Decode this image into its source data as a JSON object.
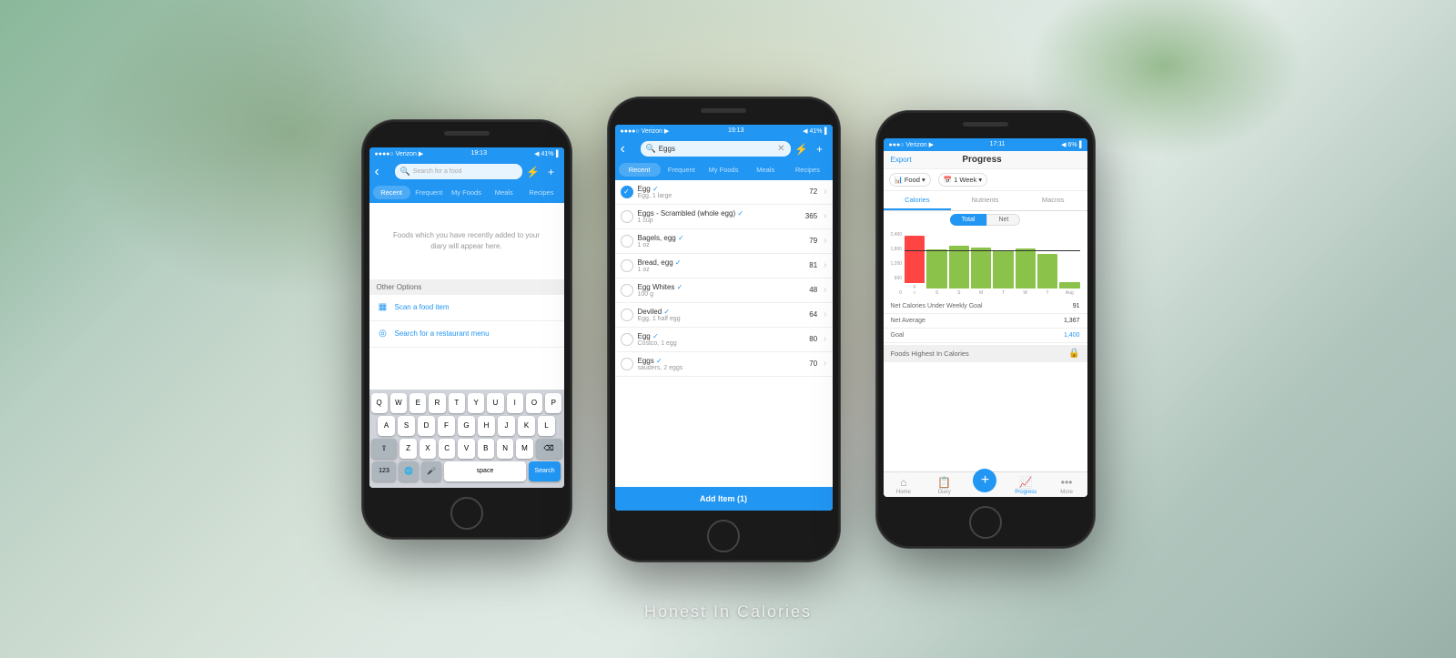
{
  "background": {
    "colors": [
      "#8ab89a",
      "#b8cfc4",
      "#dde8e2"
    ]
  },
  "honest_calories_text": "Honest In Calories",
  "phone_left": {
    "status": {
      "carrier": "●●●●○ Verizon ▶",
      "time": "19:13",
      "battery": "◀ 41%▐"
    },
    "header": {
      "back_label": "‹",
      "search_placeholder": "Search for a food",
      "filter_icon": "⚡",
      "add_icon": "+"
    },
    "tabs": [
      "Recent",
      "Frequent",
      "My Foods",
      "Meals",
      "Recipes"
    ],
    "active_tab": "Recent",
    "empty_state": "Foods which you have recently added to your diary will appear here.",
    "other_options_label": "Other Options",
    "menu_items": [
      {
        "icon": "▦",
        "label": "Scan a food item"
      },
      {
        "icon": "◎",
        "label": "Search for a restaurant menu"
      }
    ],
    "keyboard": {
      "row1": [
        "Q",
        "W",
        "E",
        "R",
        "T",
        "Y",
        "U",
        "I",
        "O",
        "P"
      ],
      "row2": [
        "A",
        "S",
        "D",
        "F",
        "G",
        "H",
        "J",
        "K",
        "L"
      ],
      "row3": [
        "⇧",
        "Z",
        "X",
        "C",
        "V",
        "B",
        "N",
        "M",
        "⌫"
      ],
      "row4_left": "123",
      "row4_globe": "🌐",
      "row4_mic": "🎤",
      "row4_space": "space",
      "row4_search": "Search"
    }
  },
  "phone_middle": {
    "status": {
      "carrier": "●●●●○ Verizon ▶",
      "time": "19:13",
      "battery": "◀ 41%▐"
    },
    "header": {
      "back_label": "‹",
      "search_value": "Eggs",
      "filter_icon": "⚡",
      "add_icon": "+"
    },
    "tabs": [
      "Recent",
      "Frequent",
      "My Foods",
      "Meals",
      "Recipes"
    ],
    "active_tab": "Recent",
    "foods": [
      {
        "name": "Egg ✓",
        "detail": "Egg, 1 large",
        "calories": 72,
        "checked": true,
        "verified": true
      },
      {
        "name": "Eggs - Scrambled (whole egg) ✓",
        "detail": "1 cup",
        "calories": 365,
        "checked": false,
        "verified": true
      },
      {
        "name": "Bagels, egg ✓",
        "detail": "1 oz",
        "calories": 79,
        "checked": false,
        "verified": true
      },
      {
        "name": "Bread, egg ✓",
        "detail": "1 oz",
        "calories": 81,
        "checked": false,
        "verified": true
      },
      {
        "name": "Egg Whites ✓",
        "detail": "100 g",
        "calories": 48,
        "checked": false,
        "verified": true
      },
      {
        "name": "Deviled ✓",
        "detail": "Egg, 1 half egg",
        "calories": 64,
        "checked": false,
        "verified": true
      },
      {
        "name": "Egg ✓",
        "detail": "Costco, 1 egg",
        "calories": 80,
        "checked": false,
        "verified": true
      },
      {
        "name": "Eggs ✓",
        "detail": "sauders, 2 eggs",
        "calories": 70,
        "checked": false,
        "verified": true
      }
    ],
    "add_button": "Add Item (1)"
  },
  "phone_right": {
    "status": {
      "carrier": "●●●○ Verizon ▶",
      "time": "17:11",
      "battery": "◀ 6%▐"
    },
    "header": {
      "export_label": "Export",
      "title": "Progress"
    },
    "filters": {
      "food_label": "Food",
      "calendar_icon": "📅",
      "week_label": "1 Week"
    },
    "sub_tabs": [
      "Calories",
      "Nutrients",
      "Macros"
    ],
    "active_sub_tab": "Calories",
    "toggles": [
      "Total",
      "Net"
    ],
    "active_toggle": "Total",
    "chart": {
      "y_labels": [
        "2,400",
        "1,800",
        "1,200",
        "600",
        "0"
      ],
      "goal_line_pct": 72,
      "bars": [
        {
          "day": "F",
          "sub": "F",
          "height_pct": 75,
          "color": "#ff4444"
        },
        {
          "day": "S",
          "sub": "S",
          "height_pct": 62,
          "color": "#8bc34a"
        },
        {
          "day": "S",
          "sub": "S",
          "height_pct": 68,
          "color": "#8bc34a"
        },
        {
          "day": "M",
          "sub": "M",
          "height_pct": 65,
          "color": "#8bc34a"
        },
        {
          "day": "T",
          "sub": "T",
          "height_pct": 60,
          "color": "#8bc34a"
        },
        {
          "day": "W",
          "sub": "W",
          "height_pct": 64,
          "color": "#8bc34a"
        },
        {
          "day": "T",
          "sub": "T",
          "height_pct": 55,
          "color": "#8bc34a"
        },
        {
          "day": "Aug",
          "sub": "Aug",
          "height_pct": 10,
          "color": "#8bc34a"
        }
      ]
    },
    "stats": [
      {
        "label": "Net Calories Under Weekly Goal",
        "value": "91",
        "blue": false
      },
      {
        "label": "Net Average",
        "value": "1,367",
        "blue": false
      },
      {
        "label": "Goal",
        "value": "1,400",
        "blue": true
      }
    ],
    "foods_highest": "Foods Highest In Calories",
    "bottom_nav": [
      {
        "icon": "⌂",
        "label": "Home",
        "active": false
      },
      {
        "icon": "📋",
        "label": "Diary",
        "active": false
      },
      {
        "icon": "+",
        "label": "",
        "active": false,
        "is_add": true
      },
      {
        "icon": "📈",
        "label": "Progress",
        "active": true
      },
      {
        "icon": "•••",
        "label": "More",
        "active": false
      }
    ]
  }
}
